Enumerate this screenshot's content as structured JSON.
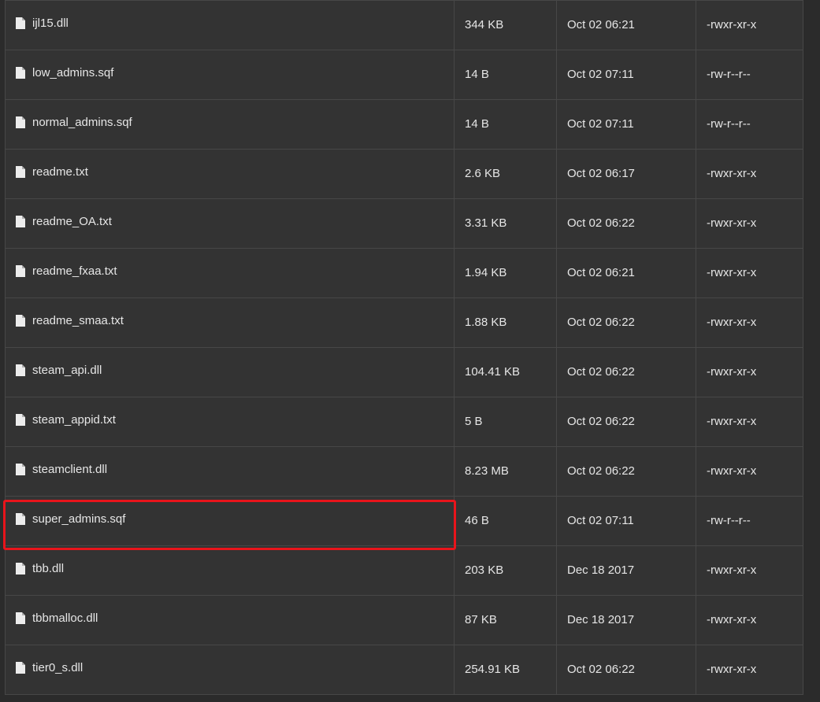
{
  "files": [
    {
      "name": "ijl15.dll",
      "size": "344 KB",
      "modified": "Oct 02 06:21",
      "permissions": "-rwxr-xr-x"
    },
    {
      "name": "low_admins.sqf",
      "size": "14 B",
      "modified": "Oct 02 07:11",
      "permissions": "-rw-r--r--"
    },
    {
      "name": "normal_admins.sqf",
      "size": "14 B",
      "modified": "Oct 02 07:11",
      "permissions": "-rw-r--r--"
    },
    {
      "name": "readme.txt",
      "size": "2.6 KB",
      "modified": "Oct 02 06:17",
      "permissions": "-rwxr-xr-x"
    },
    {
      "name": "readme_OA.txt",
      "size": "3.31 KB",
      "modified": "Oct 02 06:22",
      "permissions": "-rwxr-xr-x"
    },
    {
      "name": "readme_fxaa.txt",
      "size": "1.94 KB",
      "modified": "Oct 02 06:21",
      "permissions": "-rwxr-xr-x"
    },
    {
      "name": "readme_smaa.txt",
      "size": "1.88 KB",
      "modified": "Oct 02 06:22",
      "permissions": "-rwxr-xr-x"
    },
    {
      "name": "steam_api.dll",
      "size": "104.41 KB",
      "modified": "Oct 02 06:22",
      "permissions": "-rwxr-xr-x"
    },
    {
      "name": "steam_appid.txt",
      "size": "5 B",
      "modified": "Oct 02 06:22",
      "permissions": "-rwxr-xr-x"
    },
    {
      "name": "steamclient.dll",
      "size": "8.23 MB",
      "modified": "Oct 02 06:22",
      "permissions": "-rwxr-xr-x"
    },
    {
      "name": "super_admins.sqf",
      "size": "46 B",
      "modified": "Oct 02 07:11",
      "permissions": "-rw-r--r--"
    },
    {
      "name": "tbb.dll",
      "size": "203 KB",
      "modified": "Dec 18 2017",
      "permissions": "-rwxr-xr-x"
    },
    {
      "name": "tbbmalloc.dll",
      "size": "87 KB",
      "modified": "Dec 18 2017",
      "permissions": "-rwxr-xr-x"
    },
    {
      "name": "tier0_s.dll",
      "size": "254.91 KB",
      "modified": "Oct 02 06:22",
      "permissions": "-rwxr-xr-x"
    }
  ],
  "icon": "file-icon",
  "colors": {
    "background": "#2b2b2b",
    "row_background": "#333333",
    "grid_line": "#474747",
    "text": "#e6e6e6",
    "highlight": "#e8141b"
  },
  "highlighted_row_index": 10
}
